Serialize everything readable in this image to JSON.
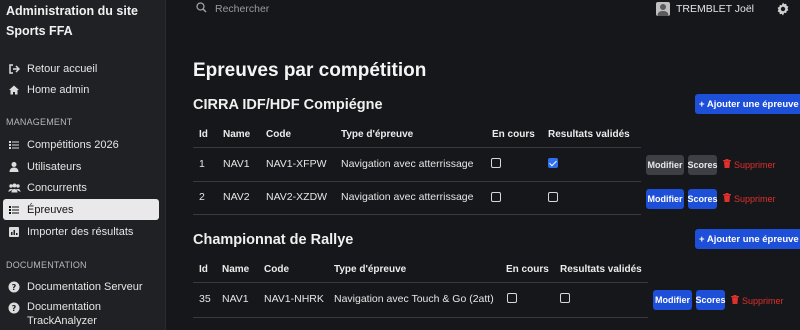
{
  "sidebar": {
    "brand_line1": "Administration du site",
    "brand_line2": "Sports FFA",
    "items_top": [
      {
        "label": "Retour accueil",
        "icon": "sign-out-icon"
      },
      {
        "label": "Home admin",
        "icon": "home-icon"
      }
    ],
    "section_management": "MANAGEMENT",
    "management_items": [
      {
        "label": "Compétitions 2026",
        "icon": "list-icon"
      },
      {
        "label": "Utilisateurs",
        "icon": "user-icon"
      },
      {
        "label": "Concurrents",
        "icon": "users-icon"
      },
      {
        "label": "Épreuves",
        "icon": "list-icon",
        "active": true
      },
      {
        "label": "Importer des résultats",
        "icon": "chart-icon"
      }
    ],
    "section_documentation": "DOCUMENTATION",
    "doc_items": [
      {
        "label": "Documentation Serveur",
        "icon": "question-icon"
      },
      {
        "label_line1": "Documentation",
        "label_line2": "TrackAnalyzer",
        "icon": "question-icon"
      }
    ]
  },
  "topbar": {
    "search_placeholder": "Rechercher",
    "user_name": "TREMBLET Joël"
  },
  "main": {
    "page_title": "Epreuves par compétition",
    "headers": {
      "id": "Id",
      "name": "Name",
      "code": "Code",
      "type": "Type d'épreuve",
      "ongoing": "En cours",
      "validated": "Resultats validés"
    },
    "add_label": "+ Ajouter une épreuve",
    "edit_label": "Modifier",
    "scores_label": "Scores",
    "delete_label": "Supprimer",
    "competitions": [
      {
        "title": "CIRRA IDF/HDF Compiégne",
        "rows": [
          {
            "id": "1",
            "name": "NAV1",
            "code": "NAV1-XFPW",
            "type": "Navigation avec atterrissage",
            "ongoing": false,
            "validated": true
          },
          {
            "id": "2",
            "name": "NAV2",
            "code": "NAV2-XZDW",
            "type": "Navigation avec atterrissage",
            "ongoing": false,
            "validated": false
          }
        ]
      },
      {
        "title": "Championnat de Rallye",
        "rows": [
          {
            "id": "35",
            "name": "NAV1",
            "code": "NAV1-NHRK",
            "type": "Navigation avec Touch & Go (2att)",
            "ongoing": false,
            "validated": false
          }
        ]
      }
    ]
  },
  "colors": {
    "accent": "#1d4fd8",
    "danger": "#e0302d",
    "background": "#16171a",
    "sidebar": "#202124"
  }
}
